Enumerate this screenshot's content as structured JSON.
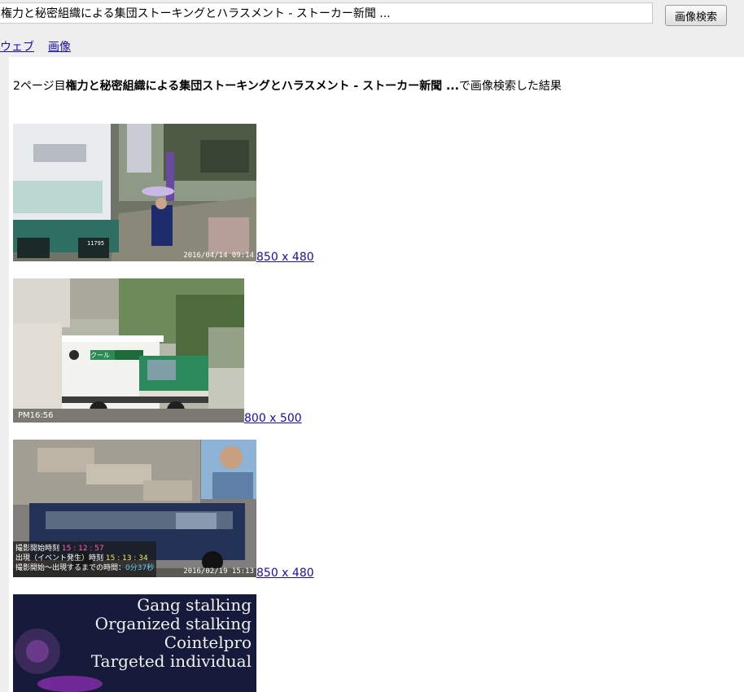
{
  "search": {
    "query": "権力と秘密組織による集団ストーキングとハラスメント - ストーカー新聞 ...",
    "button_label": "画像検索"
  },
  "tabs": [
    {
      "label": "ウェブ"
    },
    {
      "label": "画像"
    }
  ],
  "result_heading": {
    "prefix": "2ページ目",
    "query_bold": "権力と秘密組織による集団ストーキングとハラスメント - ストーカー新聞 ...",
    "suffix": "で画像検索した結果"
  },
  "results": [
    {
      "size": "850 x 480",
      "stamp": "2016/04/14 09:14",
      "plate": "11795"
    },
    {
      "size": "800 x 500",
      "stamp": "PM16:56",
      "sign": "クール"
    },
    {
      "size": "850 x 480",
      "stamp": "2016/02/19 15:13",
      "overlay": {
        "line1_label": "撮影開始時刻",
        "line1_value": "15 : 12 : 57",
        "line2_label": "出現（イベント発生）時刻",
        "line2_value": "15 : 13 : 34",
        "line3_label": "撮影開始～出現するまでの時間：",
        "line3_value": "0分37秒"
      }
    },
    {
      "caption": [
        "Gang stalking",
        "Organized stalking",
        "Cointelpro",
        "Targeted individual"
      ]
    }
  ],
  "colors": {
    "link": "#1a0dab",
    "bar": "#eeeeee"
  }
}
